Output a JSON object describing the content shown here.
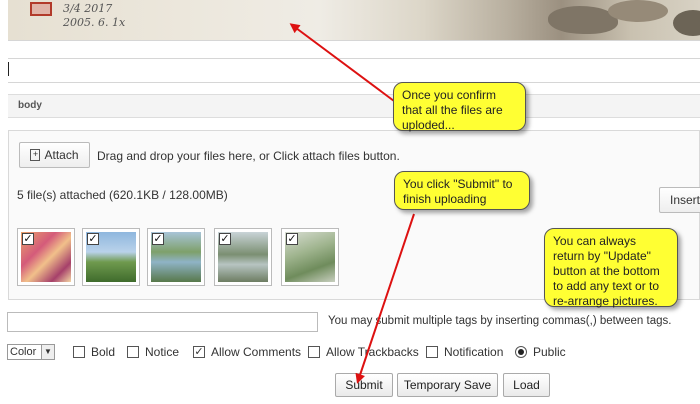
{
  "editor": {
    "body_label": "body"
  },
  "attach": {
    "button_label": "Attach",
    "drag_text": "Drag and drop your files here, or Click attach files button.",
    "count_text": "5 file(s) attached (620.1KB / 128.00MB)",
    "insert_label": "Insert",
    "thumbnails": [
      {
        "name": "thumb-1",
        "checked": true
      },
      {
        "name": "thumb-2",
        "checked": true
      },
      {
        "name": "thumb-3",
        "checked": true
      },
      {
        "name": "thumb-4",
        "checked": true
      },
      {
        "name": "thumb-5",
        "checked": true
      }
    ]
  },
  "tags": {
    "value": "",
    "help_text": "You may submit multiple tags by inserting commas(,) between tags."
  },
  "options": {
    "color_select": "Color",
    "bold": {
      "label": "Bold",
      "checked": false
    },
    "notice": {
      "label": "Notice",
      "checked": false
    },
    "allow_comments": {
      "label": "Allow Comments",
      "checked": true
    },
    "allow_trackbacks": {
      "label": "Allow Trackbacks",
      "checked": false
    },
    "notification": {
      "label": "Notification",
      "checked": false
    },
    "public": {
      "label": "Public",
      "selected": true
    }
  },
  "actions": {
    "submit": "Submit",
    "temporary_save": "Temporary Save",
    "load": "Load"
  },
  "callouts": {
    "confirm": "Once you confirm that all the files are uploded...",
    "submit": "You click \"Submit\" to finish uploading",
    "update": "You can always return by \"Update\" button at the bottom to add any text or to re-arrange pictures."
  },
  "painting_signature": "3/4 2017\n2005. 6. 1x",
  "colors": {
    "callout_fill": "#ffff33",
    "arrow": "#dd1111"
  }
}
